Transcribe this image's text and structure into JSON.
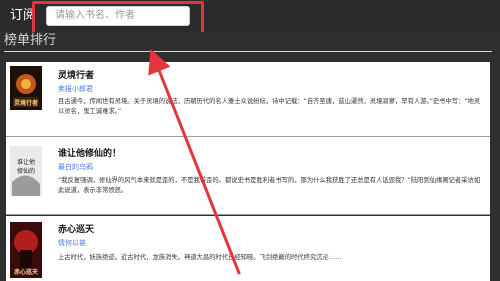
{
  "topbar": {
    "title": "订阅",
    "search_placeholder": "请输入书名、作者"
  },
  "section": {
    "title": "榜单排行"
  },
  "books": [
    {
      "title": "灵境行者",
      "author": "卖报小郎君",
      "cover_text": "灵境行者",
      "description": "且古通今，传闻世有灵境。关于灵境的说法，历朝历代的名人雅士众说纷纭，诗中记载：“自齐至唐，兹山濯然，灵境寂寥，罕有人游。”史书中写：“地灵以灵名，鬼工诚难求。”"
    },
    {
      "title": "谁让他修仙的！",
      "author": "最白的乌鸦",
      "cover_text": "谁让他修仙的",
      "description": "“我反复强调，修仙界的风气本来就是歪的，不是我带歪的。都说史书是胜利者书写的，那为什么我获胜了还总是有人诋毁我？”陆阳到仙缘阁记者采访如此说道，表示非常愤怒。"
    },
    {
      "title": "赤心巡天",
      "author": "情何以甚",
      "cover_text": "赤心巡天",
      "description": "上古时代，妖族绝迹。近古时代，龙族消失。神道大昌的时代已经知晓。飞剑绝巅的时代终究沉沦……"
    }
  ],
  "colors": {
    "highlight": "#e3363a",
    "author_link": "#3f7be8",
    "topbar_bg": "#2b2b2b",
    "content_bg": "#2f2f2f"
  }
}
